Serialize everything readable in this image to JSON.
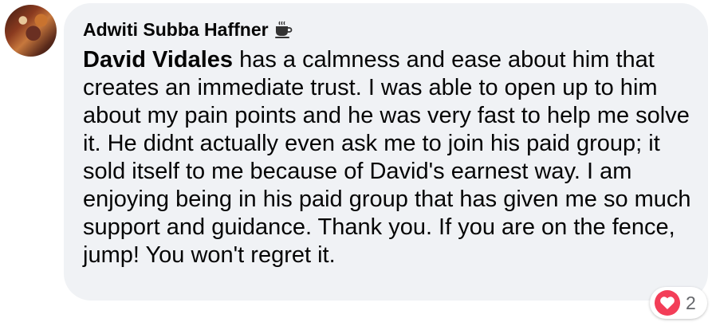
{
  "comment": {
    "author": "Adwiti Subba Haffner",
    "author_badge_icon": "coffee-cup-icon",
    "mention": "David Vidales",
    "text": " has a calmness and ease about him that creates an immediate trust. I was able to open up to him about my pain points and he was very fast to help me solve it. He didnt actually even ask me to join his paid group; it sold itself to me because of David's earnest way. I am enjoying being in his paid group that has given me so much support and guidance. Thank you. If you are on the fence, jump! You won't regret it."
  },
  "reactions": {
    "icon": "heart-icon",
    "count": "2",
    "color": "#f33e58"
  },
  "colors": {
    "bubble": "#f0f2f5",
    "text": "#050505",
    "muted": "#65676b"
  }
}
